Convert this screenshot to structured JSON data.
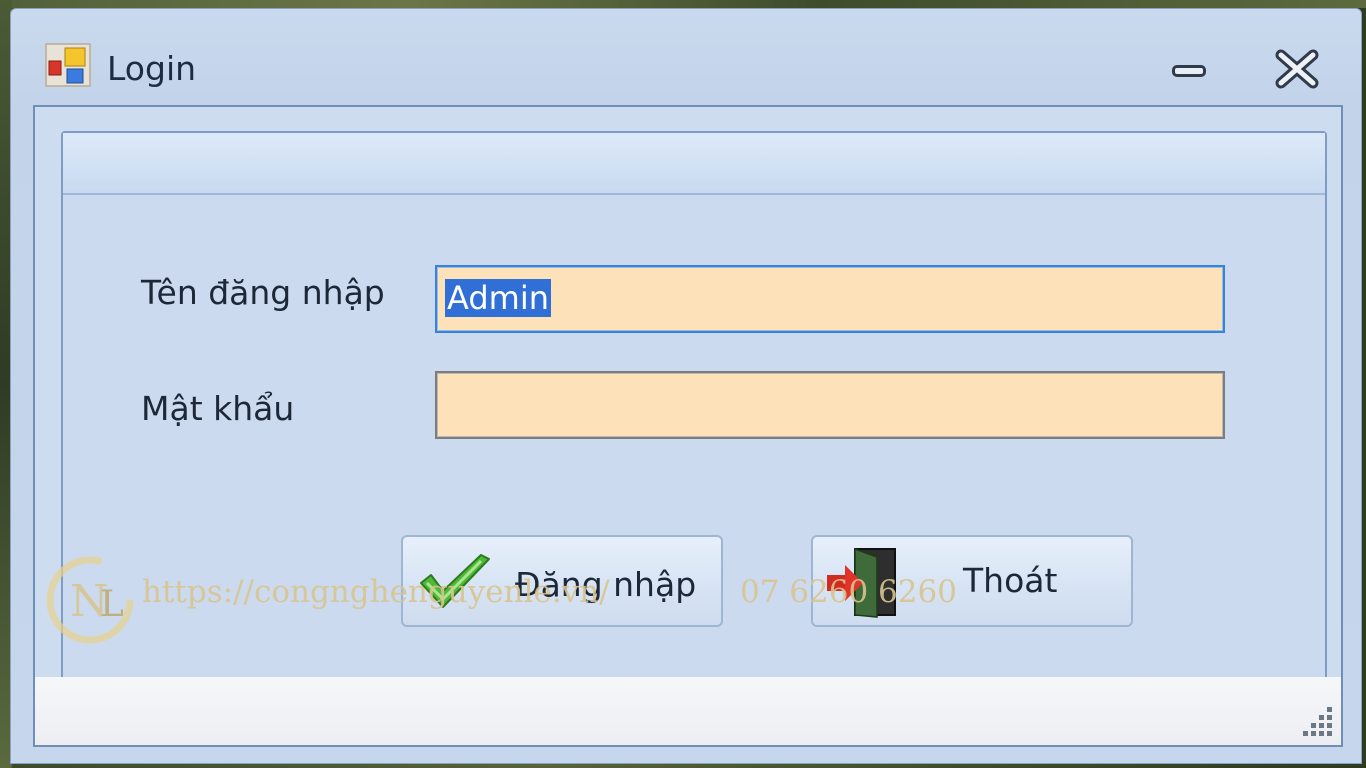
{
  "window": {
    "title": "Login",
    "icons": {
      "app": "app-form-icon",
      "minimize": "minimize-icon",
      "close": "close-icon"
    }
  },
  "form": {
    "username_label": "Tên đăng nhập",
    "username_value": "Admin",
    "password_label": "Mật khẩu",
    "password_value": "",
    "field_color": "#fde1b8",
    "focus_color": "#3b82d6"
  },
  "buttons": {
    "login_label": "Đăng nhập",
    "login_icon": "checkmark-icon",
    "exit_label": "Thoát",
    "exit_icon": "exit-door-icon"
  },
  "watermark": {
    "url": "https://congnghenguyenle.vn/",
    "phone": "07 6260 6260",
    "logo": "cnl-logo"
  }
}
